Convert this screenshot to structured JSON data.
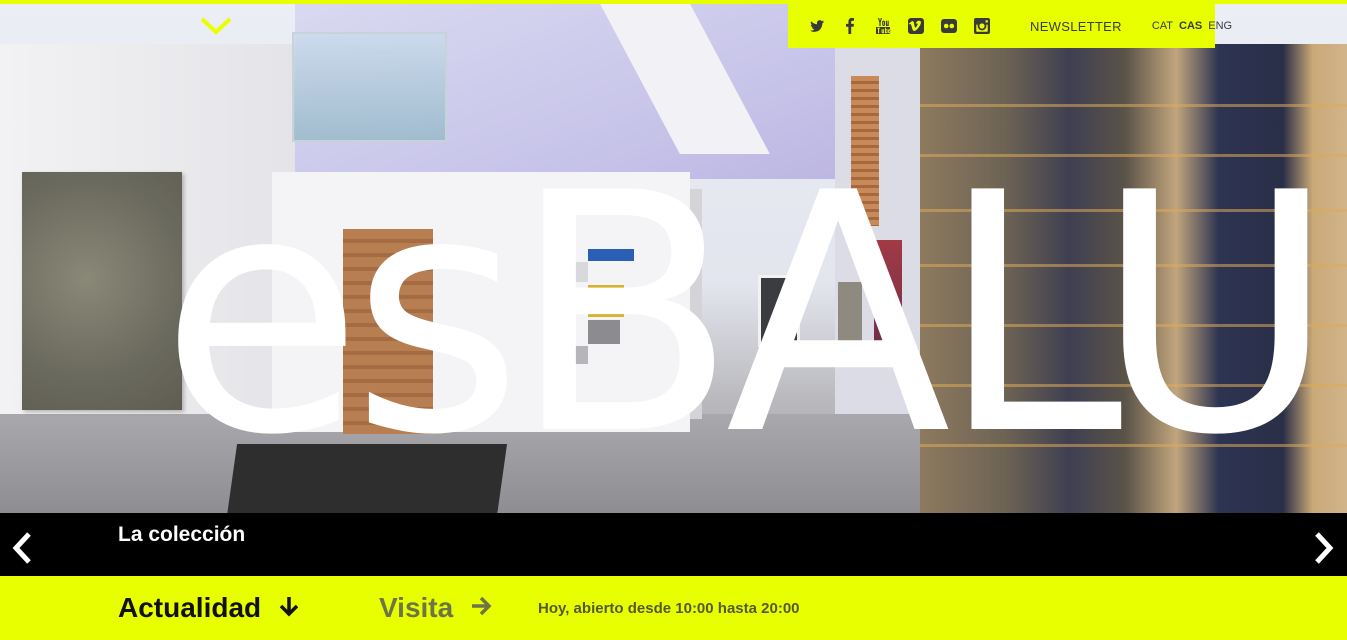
{
  "brand": {
    "logo_word": "esBALU",
    "accent_color": "#e8ff00"
  },
  "top": {
    "toggle_icon": "chevron-down-icon",
    "social": [
      {
        "name": "twitter-icon"
      },
      {
        "name": "facebook-icon"
      },
      {
        "name": "youtube-icon"
      },
      {
        "name": "vimeo-icon"
      },
      {
        "name": "flickr-icon"
      },
      {
        "name": "instagram-icon"
      }
    ],
    "newsletter_label": "NEWSLETTER",
    "languages": [
      {
        "code": "CAT",
        "active": false
      },
      {
        "code": "CAS",
        "active": true
      },
      {
        "code": "ENG",
        "active": false
      }
    ]
  },
  "slider": {
    "caption": "La colección",
    "prev_icon": "chevron-left-icon",
    "next_icon": "chevron-right-icon"
  },
  "footer_nav": {
    "actualidad_label": "Actualidad",
    "actualidad_icon": "arrow-down-icon",
    "visita_label": "Visita",
    "visita_icon": "arrow-right-icon",
    "hours_text": "Hoy, abierto desde 10:00 hasta 20:00"
  }
}
